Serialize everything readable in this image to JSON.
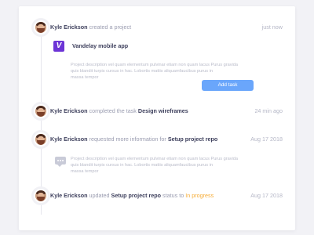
{
  "activity": [
    {
      "user": "Kyle Erickson",
      "action": "created a project",
      "time": "just now"
    },
    {
      "user": "Kyle Erickson",
      "action": "completed the task",
      "target": "Design wireframes",
      "time": "24 min ago"
    },
    {
      "user": "Kyle Erickson",
      "action": "requested more information for",
      "target": "Setup project repo",
      "time": "Aug 17 2018"
    },
    {
      "user": "Kyle Erickson",
      "action": "updated",
      "target": "Setup project repo",
      "middle": "status to",
      "status": "In progress",
      "time": "Aug 17 2018"
    }
  ],
  "project": {
    "logo_letter": "V",
    "name": "Vandelay mobile app",
    "description_lines": [
      "Project description vel quam elementum pulvinar etiam non quam lacus Purus gravida",
      "quis blandit turpis cursus in hac. Lobortis mattis aliquamfaucibus purus in",
      "massa tempor"
    ],
    "button": "Add task"
  },
  "comment": {
    "lines": [
      "Project description vel quam elementum pulvinar etiam non quam lacus Purus gravida",
      "quis blandit turpis cursus in hac. Lobortis mattis aliquamfaucibus purus in",
      "massa tempor"
    ]
  },
  "colors": {
    "accent": "#6aa6fb",
    "status": "#f6ad38",
    "logo": "#6c34d6",
    "text_dark": "#3d3f5c",
    "text_muted": "#9a9cb0"
  }
}
